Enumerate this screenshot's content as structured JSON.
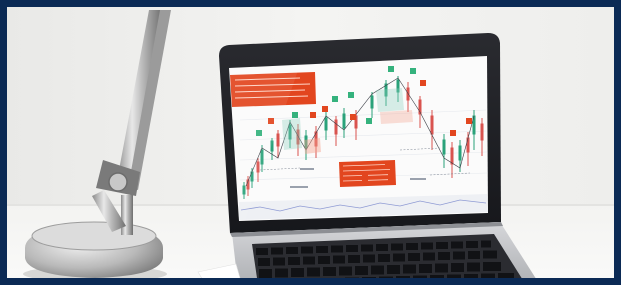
{
  "photo": {
    "frame_color": "#0b2a55",
    "wall_color": "#f1f1ef",
    "desk_color": "#f7f7f5",
    "screen_bg": "#fbfbfb",
    "annotation_color": "#e2461f",
    "bull_candle_color": "#2aa27a",
    "bear_candle_color": "#d9534f",
    "lamp_metal_color": "#c9c9c9",
    "keyboard_color": "#1c1d22"
  }
}
